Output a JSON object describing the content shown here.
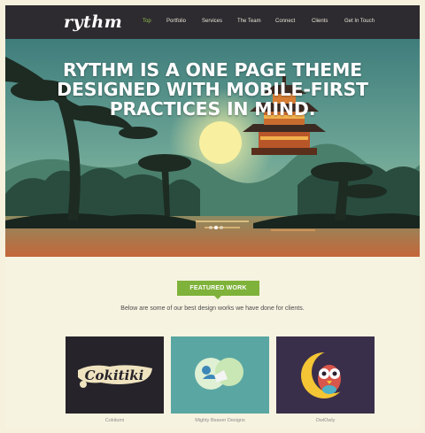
{
  "header": {
    "logo": "rythm",
    "nav": [
      "Top",
      "Portfolio",
      "Services",
      "The Team",
      "Connect",
      "Clients",
      "Get In Touch"
    ],
    "active_nav": "Top"
  },
  "hero": {
    "lines": [
      "RYTHM IS A ONE PAGE THEME",
      "DESIGNED WITH MOBILE-FIRST",
      "PRACTICES IN MIND."
    ],
    "slide_count": 3,
    "active_slide": 1
  },
  "featured": {
    "badge": "FEATURED WORK",
    "description": "Below are some of our best design works we have done for clients.",
    "items": [
      {
        "label": "Cokitumi",
        "art": "Cokitiki"
      },
      {
        "label": "Mighty Beaver Designs"
      },
      {
        "label": "OwlOwly"
      }
    ]
  },
  "colors": {
    "nav_bg": "#2d2a30",
    "accent": "#7fb23a",
    "page_bg": "#f7f3e1"
  }
}
